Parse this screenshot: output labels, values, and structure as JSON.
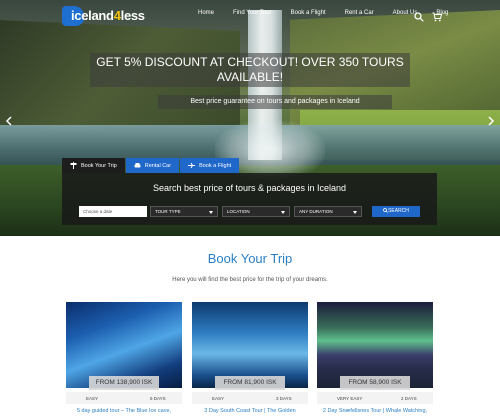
{
  "brand": {
    "logo_text_a": "iceland",
    "logo_text_b": "4",
    "logo_text_c": "less"
  },
  "nav": {
    "links": [
      "Home",
      "Find Your Tour",
      "Book a Flight",
      "Rent a Car",
      "About Us",
      "Blog"
    ],
    "icons": [
      "search-icon",
      "cart-icon"
    ]
  },
  "hero": {
    "promo_line1": "GET 5% DISCOUNT AT CHECKOUT! OVER 350 TOURS",
    "promo_line2": "AVAILABLE!",
    "guarantee": "Best price guarantee on tours and packages in Iceland"
  },
  "search": {
    "tabs": [
      "Book Your Trip",
      "Rental Car",
      "Book a Flight"
    ],
    "title": "Search best price of tours & packages in Iceland",
    "date_placeholder": "Choose a date",
    "tour_type": "TOUR TYPE",
    "location": "LOCATION",
    "duration": "ANY DURATION",
    "button": "SEARCH"
  },
  "section": {
    "title": "Book Your Trip",
    "subtitle": "Here you will find the best price for the trip of your dreams."
  },
  "cards": [
    {
      "price": "FROM 138,900 ISK",
      "level": "EASY",
      "days": "5 DAYS",
      "title": "5 day guided tour – The Blue Ice cave,"
    },
    {
      "price": "FROM 81,900 ISK",
      "level": "EASY",
      "days": "3 DAYS",
      "title": "3 Day South Coast Tour | The Golden"
    },
    {
      "price": "FROM 58,900 ISK",
      "level": "VERY EASY",
      "days": "2 DAYS",
      "title": "2 Day Snæfellsnes Tour | Whale Watching,"
    }
  ],
  "colors": {
    "accent": "#1f67c9",
    "title_blue": "#2a7fc4",
    "logo_yellow": "#f4c20d"
  }
}
